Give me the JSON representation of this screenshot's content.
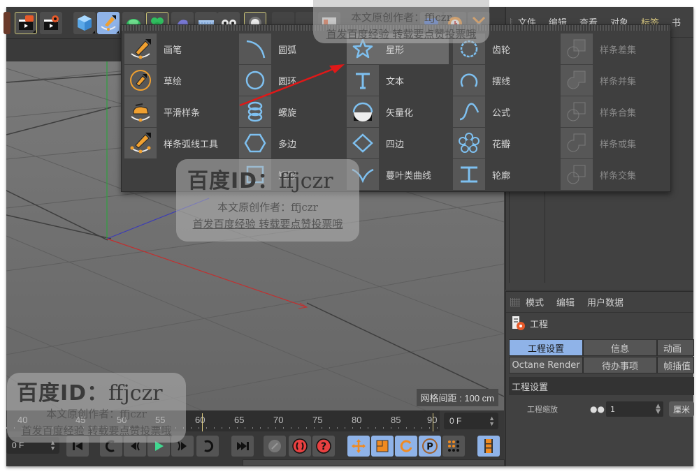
{
  "toolbar": {
    "buttons": [
      {
        "name": "render-view-icon",
        "tip": "render-view"
      },
      {
        "name": "render-settings-icon",
        "tip": "render-settings"
      },
      {
        "name": "cube-icon",
        "tip": "cube"
      },
      {
        "name": "pen-spline-icon",
        "tip": "pen"
      },
      {
        "name": "subdivision-icon",
        "tip": "subdivision"
      },
      {
        "name": "array-icon",
        "tip": "array"
      },
      {
        "name": "deformer-icon",
        "tip": "deformer"
      },
      {
        "name": "floor-icon",
        "tip": "floor"
      },
      {
        "name": "camera-icon",
        "tip": "camera"
      },
      {
        "name": "light-icon",
        "tip": "light"
      }
    ]
  },
  "spline_menu": {
    "col1": [
      {
        "label": "画笔",
        "icon": "pen-tool-icon"
      },
      {
        "label": "草绘",
        "icon": "sketch-icon"
      },
      {
        "label": "平滑样条",
        "icon": "smooth-spline-icon"
      },
      {
        "label": "样条弧线工具",
        "icon": "spline-arc-tool-icon"
      }
    ],
    "col2": [
      {
        "label": "圆弧",
        "icon": "arc-icon"
      },
      {
        "label": "圆环",
        "icon": "circle-icon"
      },
      {
        "label": "螺旋",
        "icon": "helix-icon"
      },
      {
        "label": "多边",
        "icon": "polygon-icon"
      },
      {
        "label": "矩形",
        "icon": "rectangle-icon"
      }
    ],
    "col3": [
      {
        "label": "星形",
        "icon": "star-icon",
        "selected": true
      },
      {
        "label": "文本",
        "icon": "text-icon"
      },
      {
        "label": "矢量化",
        "icon": "vectorizer-icon"
      },
      {
        "label": "四边",
        "icon": "4-side-icon"
      },
      {
        "label": "蔓叶类曲线",
        "icon": "cissoid-icon"
      }
    ],
    "col4": [
      {
        "label": "齿轮",
        "icon": "cogwheel-icon"
      },
      {
        "label": "摆线",
        "icon": "cycloid-icon"
      },
      {
        "label": "公式",
        "icon": "formula-icon"
      },
      {
        "label": "花瓣",
        "icon": "flower-icon"
      },
      {
        "label": "轮廓",
        "icon": "profile-icon"
      }
    ],
    "col5": [
      {
        "label": "样条差集",
        "icon": "spline-subtract-icon"
      },
      {
        "label": "样条并集",
        "icon": "spline-union-icon"
      },
      {
        "label": "样条合集",
        "icon": "spline-and-icon"
      },
      {
        "label": "样条或集",
        "icon": "spline-or-icon"
      },
      {
        "label": "样条交集",
        "icon": "spline-intersect-icon"
      }
    ]
  },
  "object_manager": {
    "menu": [
      "文件",
      "编辑",
      "查看",
      "对象",
      "标签",
      "书"
    ]
  },
  "attributes": {
    "menu": [
      "模式",
      "编辑",
      "用户数据"
    ],
    "title": "工程",
    "tabs_row1": [
      "工程设置",
      "信息",
      "动画"
    ],
    "tabs_row2": [
      "Octane Render",
      "待办事项",
      "帧插值"
    ],
    "section": "工程设置",
    "field_label": "工程缩放",
    "field_value": "1",
    "unit": "厘米"
  },
  "viewport": {
    "grid_spacing": "网格间距 : 100 cm"
  },
  "timeline": {
    "ticks": [
      "40",
      "45",
      "50",
      "55",
      "60",
      "65",
      "70",
      "75",
      "80",
      "85",
      "90"
    ],
    "current_frame": "0 F",
    "start_frame": "0 F"
  },
  "watermark": {
    "id": "百度ID：",
    "user": "ffjczr",
    "line1": "本文原创作者：ffjczr",
    "line2": "首发百度经验 转载要点赞投票哦"
  },
  "colors": {
    "accent_blue": "#8fb3e8",
    "icon_blue": "#7ec0f0",
    "icon_orange": "#f0a030",
    "annotation_red": "#e01818"
  }
}
